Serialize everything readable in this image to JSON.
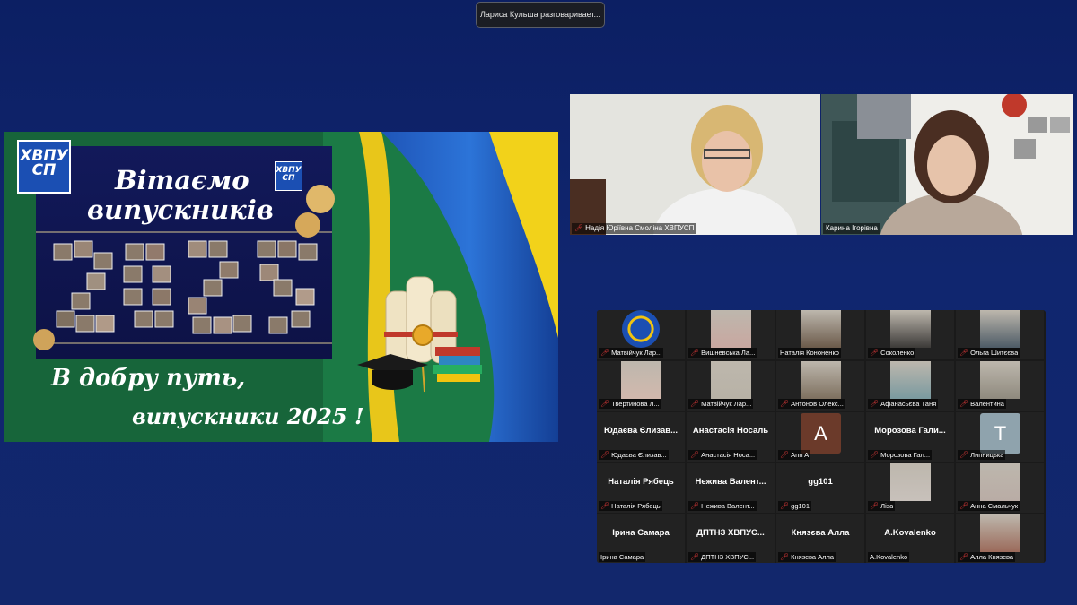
{
  "notification": {
    "text": "Лариса Кульша разговаривает..."
  },
  "slide": {
    "logo": "ХВПУ СП",
    "title_line1": "Вітаємо",
    "title_line2": "випускників",
    "year": "2025",
    "bottom_line1": "В добру путь,",
    "bottom_line2": "випускники 2025 !"
  },
  "speakers": [
    {
      "name": "Надія Юріївна Смоліна ХВПУСП"
    },
    {
      "name": "Карина Ігорівна"
    }
  ],
  "gallery": {
    "tiles": [
      {
        "label": "Матвійчук Лар...",
        "kind": "logo",
        "muted": true
      },
      {
        "label": "Вишневська Ла...",
        "kind": "photo",
        "color": "#c9a7a0",
        "muted": true
      },
      {
        "label": "Наталія Кононенко",
        "kind": "photo",
        "color": "#6b5a4a",
        "muted": false
      },
      {
        "label": "Соколенко",
        "kind": "photo",
        "color": "#3c3a38",
        "muted": true
      },
      {
        "label": "Ольга Шитєєва",
        "kind": "photo",
        "color": "#4d5b66",
        "muted": true
      },
      {
        "label": "Твертинова Л...",
        "kind": "photo",
        "color": "#d2b8ad",
        "muted": true
      },
      {
        "label": "Матвійчук Лар...",
        "kind": "photo",
        "color": "#b8b2a6",
        "muted": true
      },
      {
        "label": "Антонов Олекс...",
        "kind": "photo",
        "color": "#7e705f",
        "muted": true
      },
      {
        "label": "Афанасьєва Таня",
        "kind": "photo",
        "color": "#7a9aa0",
        "muted": true
      },
      {
        "label": "Валентина",
        "kind": "photo",
        "color": "#8f8a7e",
        "muted": true
      },
      {
        "label": "Юдаєва Єлизав...",
        "bigname": "Юдаєва Єлизав...",
        "kind": "name",
        "muted": true
      },
      {
        "label": "Анастасія Носа...",
        "bigname": "Анастасія Носаль",
        "kind": "name",
        "muted": true
      },
      {
        "label": "Ann A",
        "kind": "avatar",
        "letter": "A",
        "color": "#6b3a2a",
        "muted": true
      },
      {
        "label": "Морозова Гал...",
        "bigname": "Морозова Гали...",
        "kind": "name",
        "muted": true
      },
      {
        "label": "Липницька",
        "kind": "avatar",
        "letter": "T",
        "color": "#8fa3ad",
        "muted": true
      },
      {
        "label": "Наталія Рябець",
        "bigname": "Наталія Рябець",
        "kind": "name",
        "muted": true
      },
      {
        "label": "Нежива Валент...",
        "bigname": "Нежива Валент...",
        "kind": "name",
        "muted": true
      },
      {
        "label": "gg101",
        "bigname": "gg101",
        "kind": "name",
        "muted": true
      },
      {
        "label": "Ліза",
        "kind": "photo",
        "color": "#c8c1bb",
        "muted": true
      },
      {
        "label": "Анна Смальчук",
        "kind": "photo",
        "color": "#b9aca5",
        "muted": true
      },
      {
        "label": "Ірина Самара",
        "bigname": "Ірина Самара",
        "kind": "name",
        "muted": false
      },
      {
        "label": "ДПТНЗ ХВПУС...",
        "bigname": "ДПТНЗ ХВПУС...",
        "kind": "name",
        "muted": true
      },
      {
        "label": "Князєва Алла",
        "bigname": "Князєва Алла",
        "kind": "name",
        "muted": true
      },
      {
        "label": "A.Kovalenko",
        "bigname": "A.Kovalenko",
        "kind": "name",
        "muted": false
      },
      {
        "label": "Алла Князєва",
        "kind": "photo",
        "color": "#9b6a5a",
        "muted": true
      }
    ]
  },
  "colors": {
    "background": "#10266f",
    "mic_muted": "#e23a3a",
    "slide_green": "#1a6a3a"
  }
}
